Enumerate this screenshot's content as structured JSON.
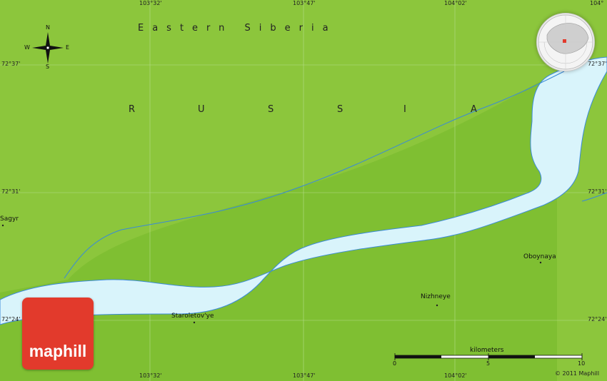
{
  "map": {
    "region_label": "Eastern Siberia",
    "country_letters": [
      "R",
      "U",
      "S",
      "S",
      "I",
      "A"
    ],
    "colors": {
      "land_high": "#8cc63c",
      "land_low": "#7fbf32",
      "river": "#d9f4fb",
      "river_edge": "#3a8ad8",
      "grid": "#b5dd8a",
      "logo": "#e23a2c"
    }
  },
  "coords": {
    "top": [
      "103°32'",
      "103°47'",
      "104°02'",
      "104°"
    ],
    "bottom": [
      "103°32'",
      "103°47'",
      "104°02'"
    ],
    "left": [
      "72°37'",
      "72°31'",
      "72°24'"
    ],
    "right": [
      "72°37'",
      "72°31'",
      "72°24'"
    ]
  },
  "places": {
    "sagyr": "Sagyr",
    "staroletovye": "Staroletov'ye",
    "nizhneye": "Nizhneye",
    "oboynaya": "Oboynaya"
  },
  "compass": {
    "n": "N",
    "s": "S",
    "e": "E",
    "w": "W"
  },
  "scale": {
    "title": "kilometers",
    "ticks": [
      "0",
      "5",
      "10"
    ]
  },
  "logo_text": "maphill",
  "copyright": "© 2011 Maphill"
}
